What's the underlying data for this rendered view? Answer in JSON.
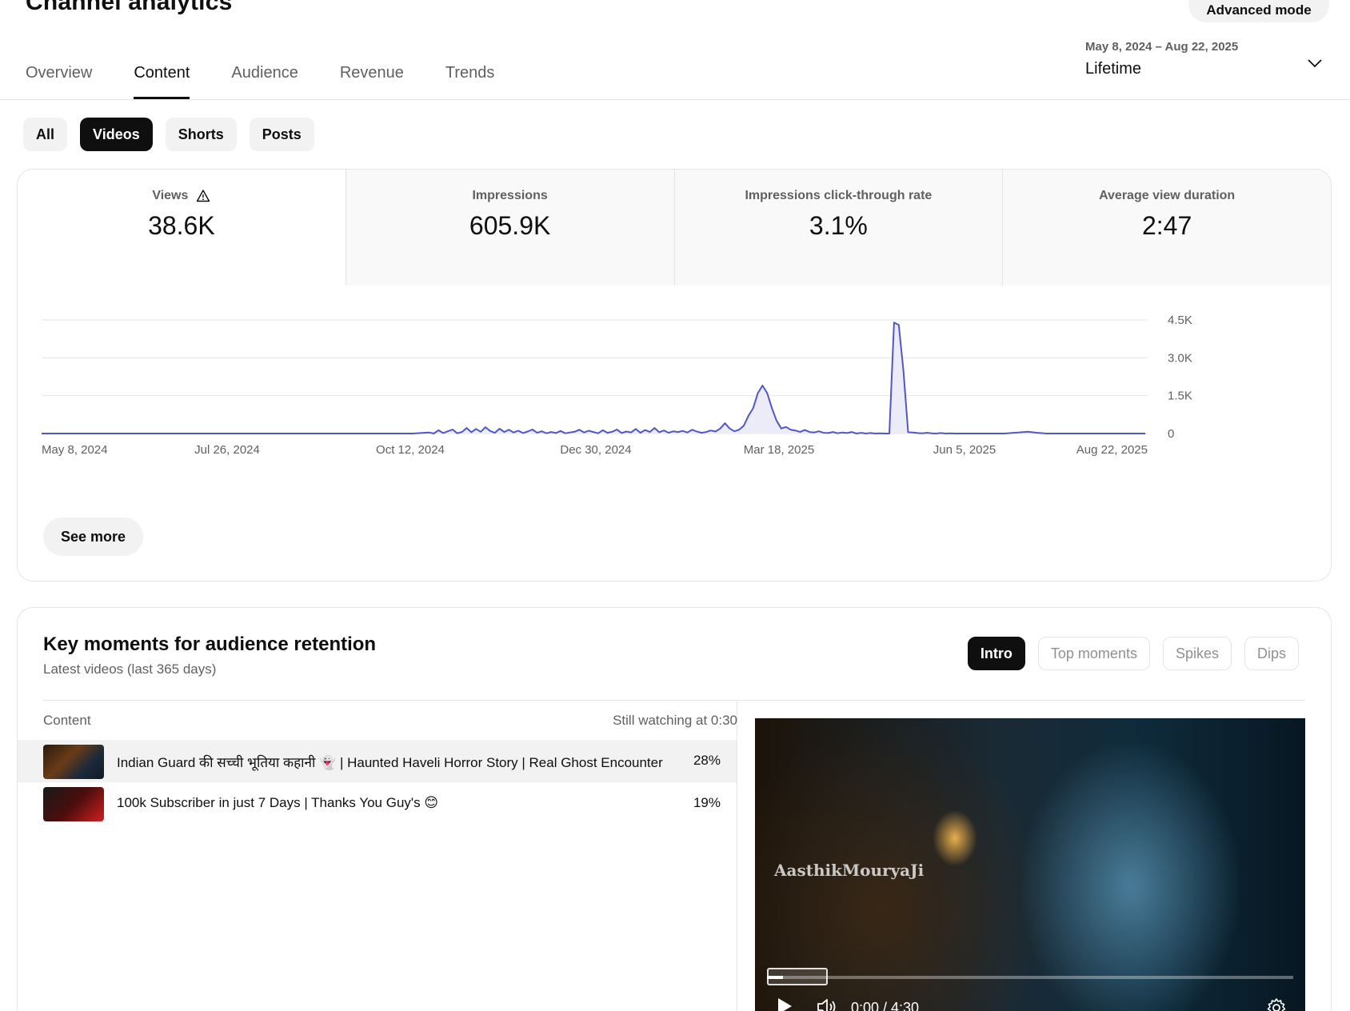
{
  "header": {
    "title": "Channel analytics",
    "advanced_mode": "Advanced mode"
  },
  "tabs": [
    {
      "label": "Overview"
    },
    {
      "label": "Content"
    },
    {
      "label": "Audience"
    },
    {
      "label": "Revenue"
    },
    {
      "label": "Trends"
    }
  ],
  "active_tab": "Content",
  "date_range": {
    "range": "May 8, 2024 – Aug 22, 2025",
    "label": "Lifetime"
  },
  "chips": [
    {
      "label": "All"
    },
    {
      "label": "Videos"
    },
    {
      "label": "Shorts"
    },
    {
      "label": "Posts"
    }
  ],
  "active_chip": "Videos",
  "metrics": [
    {
      "label": "Views",
      "value": "38.6K",
      "icon": "warning-icon"
    },
    {
      "label": "Impressions",
      "value": "605.9K"
    },
    {
      "label": "Impressions click-through rate",
      "value": "3.1%"
    },
    {
      "label": "Average view duration",
      "value": "2:47"
    }
  ],
  "chart_data": {
    "type": "area",
    "series": [
      {
        "values": [
          [
            0,
            0
          ],
          [
            158,
            0
          ],
          [
            165,
            40
          ],
          [
            167,
            0
          ],
          [
            169,
            130
          ],
          [
            171,
            20
          ],
          [
            173,
            90
          ],
          [
            175,
            160
          ],
          [
            177,
            10
          ],
          [
            179,
            60
          ],
          [
            181,
            220
          ],
          [
            183,
            50
          ],
          [
            185,
            180
          ],
          [
            187,
            70
          ],
          [
            189,
            250
          ],
          [
            191,
            100
          ],
          [
            193,
            30
          ],
          [
            195,
            190
          ],
          [
            197,
            60
          ],
          [
            199,
            150
          ],
          [
            201,
            40
          ],
          [
            203,
            110
          ],
          [
            205,
            20
          ],
          [
            207,
            80
          ],
          [
            209,
            160
          ],
          [
            211,
            30
          ],
          [
            213,
            90
          ],
          [
            215,
            10
          ],
          [
            217,
            60
          ],
          [
            219,
            20
          ],
          [
            221,
            100
          ],
          [
            223,
            10
          ],
          [
            225,
            40
          ],
          [
            227,
            70
          ],
          [
            229,
            150
          ],
          [
            231,
            40
          ],
          [
            233,
            110
          ],
          [
            235,
            60
          ],
          [
            237,
            10
          ],
          [
            239,
            130
          ],
          [
            241,
            30
          ],
          [
            243,
            70
          ],
          [
            245,
            160
          ],
          [
            247,
            20
          ],
          [
            249,
            80
          ],
          [
            251,
            40
          ],
          [
            253,
            180
          ],
          [
            255,
            30
          ],
          [
            257,
            140
          ],
          [
            259,
            60
          ],
          [
            261,
            220
          ],
          [
            263,
            50
          ],
          [
            265,
            120
          ],
          [
            267,
            30
          ],
          [
            269,
            90
          ],
          [
            271,
            60
          ],
          [
            273,
            100
          ],
          [
            275,
            40
          ],
          [
            277,
            150
          ],
          [
            279,
            80
          ],
          [
            281,
            30
          ],
          [
            283,
            60
          ],
          [
            285,
            120
          ],
          [
            287,
            80
          ],
          [
            289,
            200
          ],
          [
            291,
            410
          ],
          [
            293,
            200
          ],
          [
            295,
            90
          ],
          [
            297,
            150
          ],
          [
            299,
            310
          ],
          [
            301,
            700
          ],
          [
            303,
            1000
          ],
          [
            305,
            1600
          ],
          [
            307,
            1900
          ],
          [
            309,
            1600
          ],
          [
            311,
            1000
          ],
          [
            313,
            500
          ],
          [
            315,
            200
          ],
          [
            317,
            260
          ],
          [
            319,
            150
          ],
          [
            321,
            120
          ],
          [
            323,
            60
          ],
          [
            325,
            140
          ],
          [
            327,
            60
          ],
          [
            329,
            40
          ],
          [
            331,
            90
          ],
          [
            333,
            30
          ],
          [
            335,
            20
          ],
          [
            337,
            60
          ],
          [
            339,
            10
          ],
          [
            341,
            40
          ],
          [
            343,
            20
          ],
          [
            345,
            60
          ],
          [
            347,
            0
          ],
          [
            349,
            30
          ],
          [
            351,
            0
          ],
          [
            353,
            20
          ],
          [
            355,
            0
          ],
          [
            357,
            10
          ],
          [
            359,
            0
          ],
          [
            361,
            0
          ],
          [
            363,
            4400
          ],
          [
            365,
            4300
          ],
          [
            367,
            2500
          ],
          [
            369,
            50
          ],
          [
            371,
            40
          ],
          [
            373,
            20
          ],
          [
            375,
            10
          ],
          [
            377,
            30
          ],
          [
            379,
            10
          ],
          [
            381,
            0
          ],
          [
            383,
            20
          ],
          [
            385,
            0
          ],
          [
            387,
            10
          ],
          [
            389,
            0
          ],
          [
            391,
            0
          ],
          [
            395,
            0
          ],
          [
            410,
            0
          ],
          [
            420,
            70
          ],
          [
            424,
            30
          ],
          [
            428,
            0
          ],
          [
            440,
            0
          ],
          [
            470,
            0
          ]
        ]
      }
    ],
    "x_ticks": [
      "May 8, 2024",
      "Jul 26, 2024",
      "Oct 12, 2024",
      "Dec 30, 2024",
      "Mar 18, 2025",
      "Jun 5, 2025",
      "Aug 22, 2025"
    ],
    "y_ticks": [
      "4.5K",
      "3.0K",
      "1.5K",
      "0"
    ],
    "ylim": [
      0,
      4500
    ],
    "xlim": [
      0,
      471
    ],
    "color": "#5256c6",
    "fill": "#ecebf8",
    "grid": true
  },
  "see_more": "See more",
  "key_moments": {
    "title": "Key moments for audience retention",
    "subtitle": "Latest videos (last 365 days)",
    "filters": [
      {
        "label": "Intro"
      },
      {
        "label": "Top moments"
      },
      {
        "label": "Spikes"
      },
      {
        "label": "Dips"
      }
    ],
    "active_filter": "Intro",
    "table": {
      "col_content": "Content",
      "col_metric": "Still watching at 0:30",
      "rows": [
        {
          "title": "Indian Guard की सच्ची भूतिया कहानी 👻 | Haunted Haveli Horror Story | Real Ghost Encounter",
          "value": "28%"
        },
        {
          "title": "100k Subscriber in just 7 Days | Thanks You Guy's 😊",
          "value": "19%"
        }
      ]
    },
    "player": {
      "watermark": "AasthikMouryaJi",
      "time": "0:00 / 4:30",
      "progress": 0.03
    }
  }
}
